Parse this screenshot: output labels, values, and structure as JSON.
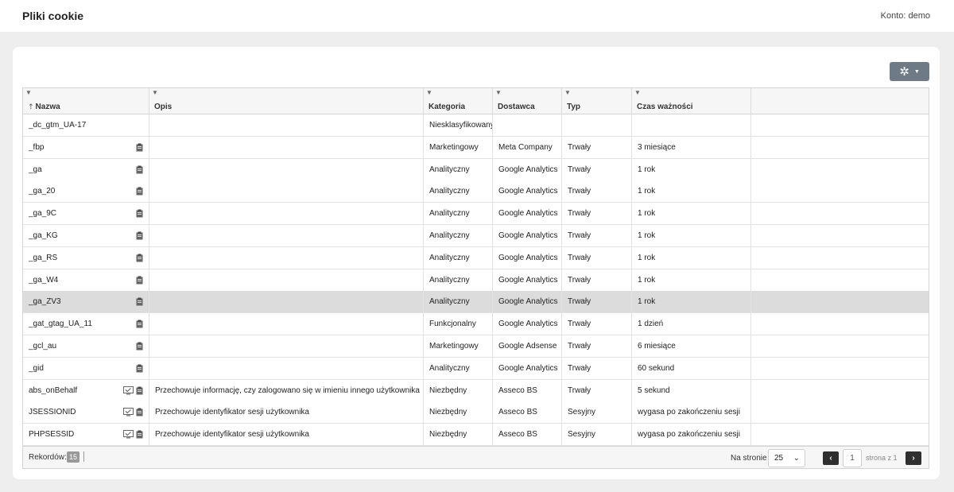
{
  "header": {
    "title": "Pliki cookie",
    "account": "Konto: demo"
  },
  "toolbar": {
    "tools_icon": "gear-icon"
  },
  "table": {
    "columns": [
      "Nazwa",
      "Opis",
      "Kategoria",
      "Dostawca",
      "Typ",
      "Czas ważności"
    ],
    "rows": [
      {
        "name": "_dc_gtm_UA-17",
        "desc": "",
        "category": "Niesklasyfikowany",
        "provider": "",
        "type": "",
        "expiry": "",
        "icons": []
      },
      {
        "name": "_fbp",
        "desc": "",
        "category": "Marketingowy",
        "provider": "Meta Company",
        "type": "Trwały",
        "expiry": "3 miesiące",
        "icons": [
          "clipboard-icon"
        ]
      },
      {
        "name": "_ga",
        "desc": "",
        "category": "Analityczny",
        "provider": "Google Analytics",
        "type": "Trwały",
        "expiry": "1 rok",
        "icons": [
          "clipboard-icon"
        ]
      },
      {
        "name": "_ga_20",
        "desc": "",
        "category": "Analityczny",
        "provider": "Google Analytics",
        "type": "Trwały",
        "expiry": "1 rok",
        "icons": [
          "clipboard-icon"
        ]
      },
      {
        "name": "_ga_9C",
        "desc": "",
        "category": "Analityczny",
        "provider": "Google Analytics",
        "type": "Trwały",
        "expiry": "1 rok",
        "icons": [
          "clipboard-icon"
        ]
      },
      {
        "name": "_ga_KG",
        "desc": "",
        "category": "Analityczny",
        "provider": "Google Analytics",
        "type": "Trwały",
        "expiry": "1 rok",
        "icons": [
          "clipboard-icon"
        ]
      },
      {
        "name": "_ga_RS",
        "desc": "",
        "category": "Analityczny",
        "provider": "Google Analytics",
        "type": "Trwały",
        "expiry": "1 rok",
        "icons": [
          "clipboard-icon"
        ]
      },
      {
        "name": "_ga_W4",
        "desc": "",
        "category": "Analityczny",
        "provider": "Google Analytics",
        "type": "Trwały",
        "expiry": "1 rok",
        "icons": [
          "clipboard-icon"
        ]
      },
      {
        "name": "_ga_ZV3",
        "desc": "",
        "category": "Analityczny",
        "provider": "Google Analytics",
        "type": "Trwały",
        "expiry": "1 rok",
        "icons": [
          "clipboard-icon"
        ],
        "selected": true
      },
      {
        "name": "_gat_gtag_UA_11",
        "desc": "",
        "category": "Funkcjonalny",
        "provider": "Google Analytics",
        "type": "Trwały",
        "expiry": "1 dzień",
        "icons": [
          "clipboard-icon"
        ]
      },
      {
        "name": "_gcl_au",
        "desc": "",
        "category": "Marketingowy",
        "provider": "Google Adsense",
        "type": "Trwały",
        "expiry": "6 miesiące",
        "icons": [
          "clipboard-icon"
        ]
      },
      {
        "name": "_gid",
        "desc": "",
        "category": "Analityczny",
        "provider": "Google Analytics",
        "type": "Trwały",
        "expiry": "60 sekund",
        "icons": [
          "clipboard-icon"
        ]
      },
      {
        "name": "abs_onBehalf",
        "desc": "Przechowuje informację, czy zalogowano się w imieniu innego użytkownika",
        "category": "Niezbędny",
        "provider": "Asseco BS",
        "type": "Trwały",
        "expiry": "5 sekund",
        "icons": [
          "monitor-check-icon",
          "clipboard-icon"
        ]
      },
      {
        "name": "JSESSIONID",
        "desc": "Przechowuje identyfikator sesji użytkownika",
        "category": "Niezbędny",
        "provider": "Asseco BS",
        "type": "Sesyjny",
        "expiry": "wygasa po zakończeniu sesji",
        "icons": [
          "monitor-check-icon",
          "clipboard-icon"
        ]
      },
      {
        "name": "PHPSESSID",
        "desc": "Przechowuje identyfikator sesji użytkownika",
        "category": "Niezbędny",
        "provider": "Asseco BS",
        "type": "Sesyjny",
        "expiry": "wygasa po zakończeniu sesji",
        "icons": [
          "monitor-check-icon",
          "clipboard-icon"
        ]
      }
    ]
  },
  "footer": {
    "records_label": "Rekordów:",
    "records_count": "15",
    "per_page_label": "Na stronie",
    "per_page_value": "25",
    "page_current": "1",
    "page_total_label": "strona z 1"
  }
}
